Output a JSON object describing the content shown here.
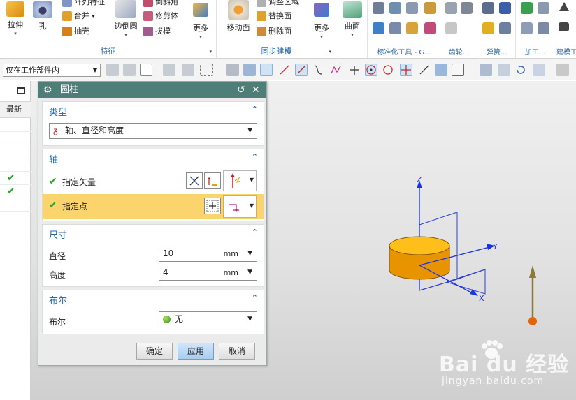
{
  "ribbon": {
    "feature_group": {
      "title": "特征",
      "extrude": "拉伸",
      "hole": "孔",
      "pattern_feature": "阵列特征",
      "unite": "合并",
      "shell": "抽壳",
      "edge_blend": "边倒圆",
      "chamfer": "倒斜角",
      "trim_body": "修剪体",
      "draft": "拔模",
      "more": "更多"
    },
    "sync_group": {
      "title": "同步建模",
      "move_face": "移动面",
      "adjust_region": "调整区域",
      "replace_face": "替换面",
      "delete_face": "删除面",
      "more": "更多"
    },
    "surface_group": {
      "surface": "曲面"
    },
    "groups": {
      "standard_parts": "标准化工具 - G...",
      "gear": "齿轮...",
      "spring": "弹簧...",
      "machining": "加工...",
      "modeling": "建模工"
    }
  },
  "toolbar2": {
    "filter_value": "仅在工作部件内"
  },
  "navigator": {
    "column_header": "最新",
    "rows": [
      {
        "checked": false
      },
      {
        "checked": false
      },
      {
        "checked": false
      },
      {
        "checked": false
      },
      {
        "checked": false
      },
      {
        "checked": true
      },
      {
        "checked": true
      }
    ]
  },
  "dialog": {
    "title": "圆柱",
    "type_section": {
      "title": "类型",
      "selected": "轴、直径和高度"
    },
    "axis_section": {
      "title": "轴",
      "specify_vector": "指定矢量",
      "specify_point": "指定点"
    },
    "dims_section": {
      "title": "尺寸",
      "diameter_label": "直径",
      "diameter_value": "10",
      "diameter_unit": "mm",
      "height_label": "高度",
      "height_value": "4",
      "height_unit": "mm"
    },
    "boolean_section": {
      "title": "布尔",
      "label": "布尔",
      "value": "无"
    },
    "buttons": {
      "ok": "确定",
      "apply": "应用",
      "cancel": "取消"
    }
  },
  "viewport": {
    "axis_z": "Z",
    "axis_y": "Y",
    "axis_x": "X",
    "cylinder_color": "#f5a800"
  },
  "watermark": {
    "brand": "Bai du 经验",
    "url": "jingyan.baidu.com"
  }
}
